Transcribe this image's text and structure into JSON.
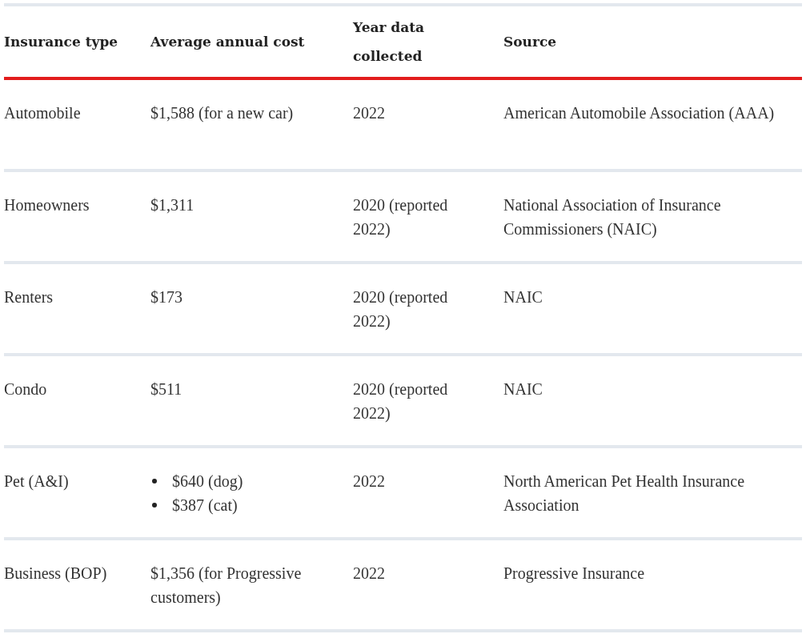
{
  "table": {
    "columns": [
      "Insurance type",
      "Average annual cost",
      "Year data collected",
      "Source"
    ],
    "rows": [
      {
        "type": "Automobile",
        "cost": "$1,588 (for a new car)",
        "year": "2022",
        "source": "American Automobile Association (AAA)"
      },
      {
        "type": "Homeowners",
        "cost": "$1,311",
        "year": "2020 (reported 2022)",
        "source": "National Association of Insurance Commissioners (NAIC)"
      },
      {
        "type": "Renters",
        "cost": "$173",
        "year": "2020 (reported 2022)",
        "source": "NAIC"
      },
      {
        "type": "Condo",
        "cost": "$511",
        "year": "2020 (reported 2022)",
        "source": "NAIC"
      },
      {
        "type": "Pet (A&I)",
        "cost_items": [
          "$640 (dog)",
          "$387 (cat)"
        ],
        "year": "2022",
        "source": "North American Pet Health Insurance Association"
      },
      {
        "type": "Business (BOP)",
        "cost": "$1,356 (for Progressive customers)",
        "year": "2022",
        "source": "Progressive Insurance"
      }
    ]
  }
}
